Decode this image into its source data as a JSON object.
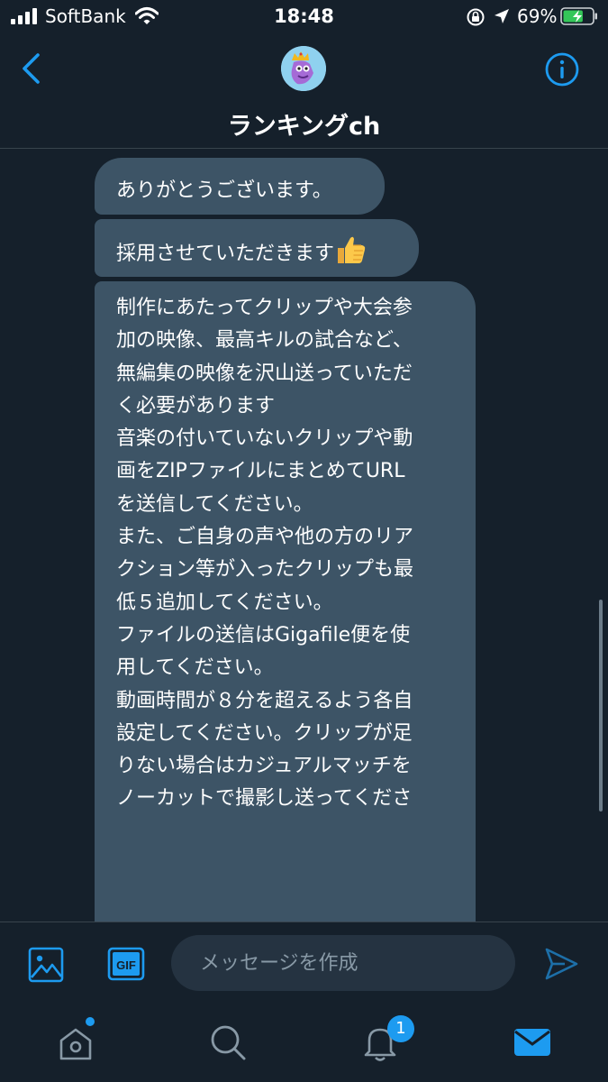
{
  "status_bar": {
    "carrier": "SoftBank",
    "time": "18:48",
    "battery": "69%",
    "battery_level": 0.69
  },
  "header": {
    "title": "ランキングch",
    "back_icon": "chevron-left-icon",
    "info_icon": "info-icon"
  },
  "messages": [
    {
      "text": "ありがとうございます。"
    },
    {
      "text": "採用させていただきます",
      "emoji": "thumbs-up"
    },
    {
      "lines": [
        "制作にあたってクリップや大会参",
        "加の映像、最高キルの試合など、",
        "無編集の映像を沢山送っていただ",
        "く必要があります",
        "",
        "音楽の付いていないクリップや動",
        "画をZIPファイルにまとめてURL",
        "を送信してください。",
        "",
        "また、ご自身の声や他の方のリア",
        "クション等が入ったクリップも最",
        "低５追加してください。",
        "",
        "ファイルの送信はGigafile便を使",
        "用してください。",
        "",
        "動画時間が８分を超えるよう各自",
        "設定してください。クリップが足",
        "りない場合はカジュアルマッチを",
        "ノーカットで撮影し送ってくださ"
      ]
    }
  ],
  "composer": {
    "placeholder": "メッセージを作成",
    "gif_label": "GIF"
  },
  "tabbar": {
    "notification_count": "1"
  },
  "colors": {
    "background": "#15202b",
    "bubble": "#3d5466",
    "accent": "#1d9bf0"
  }
}
